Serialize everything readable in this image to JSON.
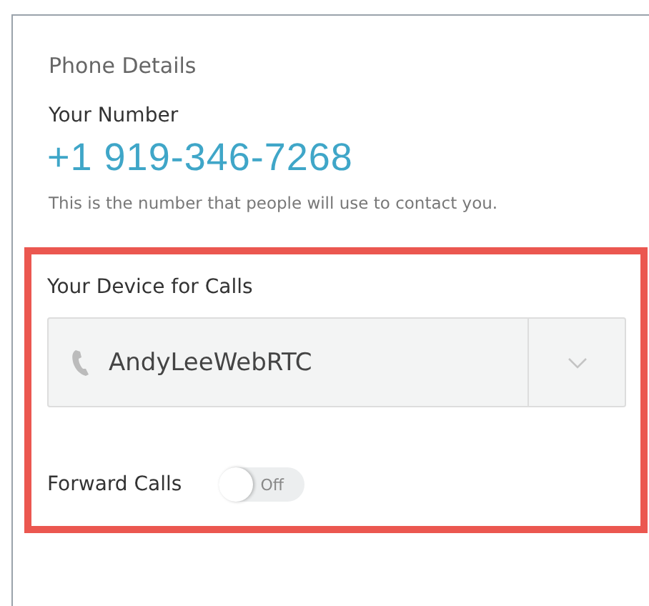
{
  "panel": {
    "title": "Phone Details"
  },
  "number": {
    "label": "Your Number",
    "value": "+1 919-346-7268",
    "hint": "This is the number that people will use to contact you."
  },
  "device": {
    "label": "Your Device for Calls",
    "value": "AndyLeeWebRTC"
  },
  "forward": {
    "label": "Forward Calls",
    "on": false,
    "state_text": "Off"
  }
}
